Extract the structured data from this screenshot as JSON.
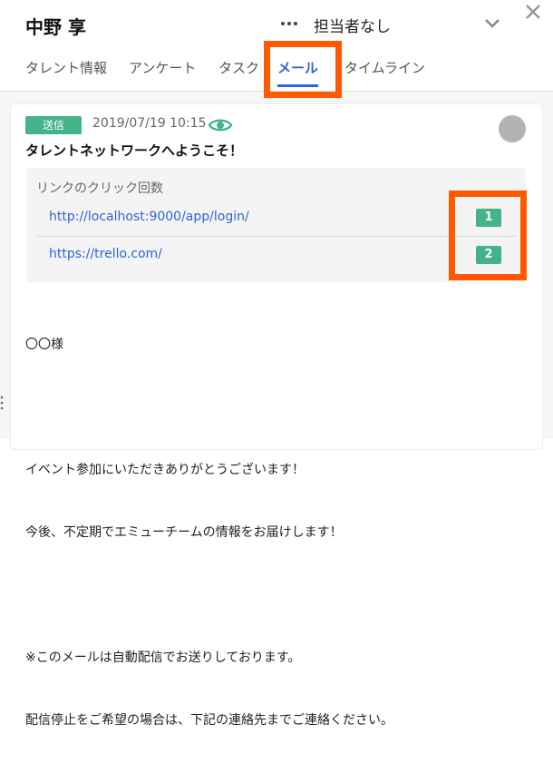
{
  "header": {
    "name": "中野 享",
    "more_icon": "more-horizontal-icon",
    "assignee": "担当者なし",
    "chevron_icon": "chevron-down-icon",
    "close_icon": "close-icon"
  },
  "tabs": [
    {
      "label": "タレント情報",
      "active": false
    },
    {
      "label": "アンケート",
      "active": false
    },
    {
      "label": "タスク",
      "active": false
    },
    {
      "label": "メール",
      "active": true
    },
    {
      "label": "タイムライン",
      "active": false
    }
  ],
  "mail": {
    "status_badge": "送信",
    "datetime": "2019/07/19 10:15",
    "eye_icon": "eye-icon",
    "subject": "タレントネットワークへようこそ！",
    "clicks": {
      "title": "リンクのクリック回数",
      "links": [
        {
          "url": "http://localhost:9000/app/login/",
          "count": "1"
        },
        {
          "url": "https://trello.com/",
          "count": "2"
        }
      ]
    },
    "body_lines": [
      "〇〇様",
      "",
      "イベント参加にいただきありがとうございます！",
      "今後、不定期でエミューチームの情報をお届けします！",
      "",
      "※このメールは自動配信でお送りしております。",
      "配信停止をご希望の場合は、下記の連絡先までご連絡ください。"
    ]
  },
  "colors": {
    "accent": "#2f64d6",
    "badge_green": "#43b38a",
    "highlight_orange": "#ff5a00",
    "avatar_gray": "#b3b3b3"
  }
}
